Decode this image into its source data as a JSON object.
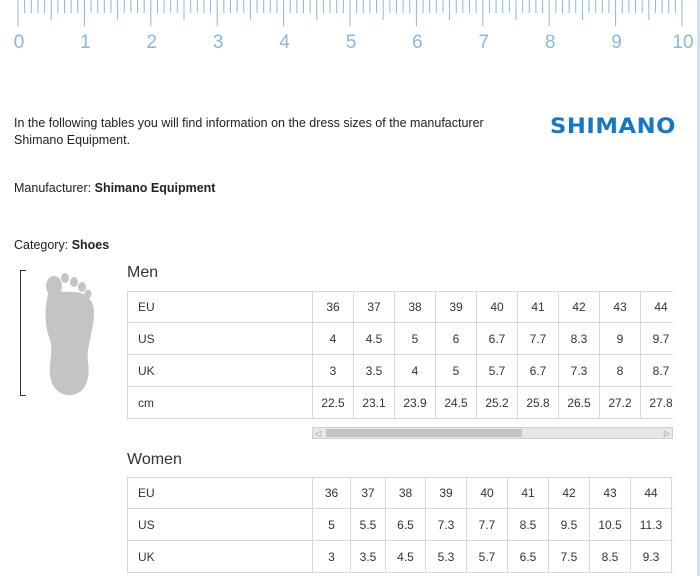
{
  "ruler": {
    "labels": [
      "0",
      "1",
      "2",
      "3",
      "4",
      "5",
      "6",
      "7",
      "8",
      "9",
      "10"
    ]
  },
  "intro": "In the following tables you will find information on the dress sizes of the manufacturer Shimano Equipment.",
  "logo": "SHIMANO",
  "manufacturer": {
    "label": "Manufacturer:",
    "value": "Shimano Equipment"
  },
  "category": {
    "label": "Category:",
    "value": "Shoes"
  },
  "colors": {
    "ruler": "#88b9dc",
    "logo": "#1677c4"
  },
  "men": {
    "title": "Men",
    "rows": [
      {
        "head": "EU",
        "values": [
          "36",
          "37",
          "38",
          "39",
          "40",
          "41",
          "42",
          "43",
          "44"
        ]
      },
      {
        "head": "US",
        "values": [
          "4",
          "4.5",
          "5",
          "6",
          "6.7",
          "7.7",
          "8.3",
          "9",
          "9.7"
        ]
      },
      {
        "head": "UK",
        "values": [
          "3",
          "3.5",
          "4",
          "5",
          "5.7",
          "6.7",
          "7.3",
          "8",
          "8.7"
        ]
      },
      {
        "head": "cm",
        "values": [
          "22.5",
          "23.1",
          "23.9",
          "24.5",
          "25.2",
          "25.8",
          "26.5",
          "27.2",
          "27.8"
        ]
      }
    ]
  },
  "women": {
    "title": "Women",
    "rows": [
      {
        "head": "EU",
        "values": [
          "36",
          "37",
          "38",
          "39",
          "40",
          "41",
          "42",
          "43",
          "44"
        ]
      },
      {
        "head": "US",
        "values": [
          "5",
          "5.5",
          "6.5",
          "7.3",
          "7.7",
          "8.5",
          "9.5",
          "10.5",
          "11.3"
        ]
      },
      {
        "head": "UK",
        "values": [
          "3",
          "3.5",
          "4.5",
          "5.3",
          "5.7",
          "6.5",
          "7.5",
          "8.5",
          "9.3"
        ]
      }
    ]
  },
  "scrollbar": {
    "left_arrow": "◁",
    "right_arrow": "▷"
  }
}
